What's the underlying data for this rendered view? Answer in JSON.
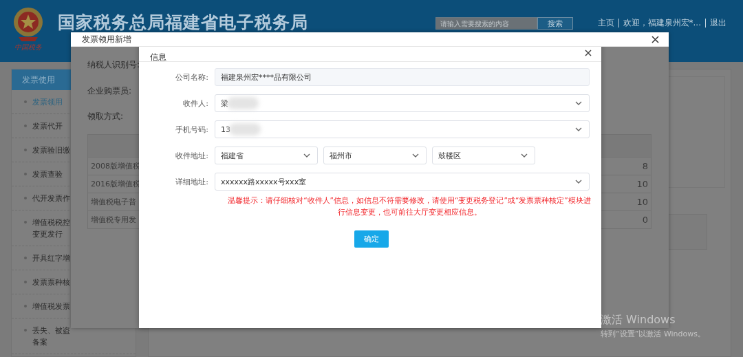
{
  "header": {
    "logo_text": "中国税务",
    "title": "国家税务总局福建省电子税务局",
    "search": {
      "placeholder": "请输入需要搜索的内容",
      "button": "搜索"
    },
    "links": [
      "主页",
      "欢迎，福建泉州宏*...",
      "退出"
    ]
  },
  "sidebar": {
    "title": "发票使用",
    "items": [
      {
        "label": "发票领用",
        "selected": true
      },
      {
        "label": "发票代开",
        "selected": false
      },
      {
        "label": "发票验旧缴",
        "selected": false
      },
      {
        "label": "发票查验",
        "selected": false
      },
      {
        "label": "代开发票作",
        "selected": false
      },
      {
        "label": "增值税税控变更发行",
        "selected": false
      },
      {
        "label": "开具红字增",
        "selected": false
      },
      {
        "label": "发票票种核",
        "selected": false
      },
      {
        "label": "增值税发票",
        "selected": false
      },
      {
        "label": "丢失、被盗备案",
        "selected": false
      }
    ]
  },
  "invoice_dialog": {
    "title": "发票领用新增",
    "fields": [
      "纳税人识别号:",
      "企业购票员:",
      "领取方式:"
    ],
    "table": {
      "rows": [
        [
          "2008版增值税",
          "8"
        ],
        [
          "2016版增值税",
          "10"
        ],
        [
          "增值税电子普",
          "10"
        ],
        [
          "增值税专用发",
          "0"
        ]
      ]
    }
  },
  "info_dialog": {
    "title": "信息",
    "fields": [
      {
        "kind": "readonly",
        "label": "公司名称:",
        "value": "福建泉州宏****品有限公司"
      },
      {
        "kind": "select",
        "label": "收件人:",
        "value": "梁",
        "redacted": true
      },
      {
        "kind": "select",
        "label": "手机号码:",
        "value": "13",
        "redacted": true
      },
      {
        "kind": "address",
        "label": "收件地址:",
        "values": [
          "福建省",
          "福州市",
          "鼓楼区"
        ]
      },
      {
        "kind": "select",
        "label": "详细地址:",
        "value": "xxxxxx路xxxxx号xxx室"
      }
    ],
    "notice": "温馨提示：请仔细核对“收件人”信息，如信息不符需要修改，请使用“变更税务登记”或“发票票种核定”模块进行信息变更，也可前往大厅变更相应信息。",
    "confirm": "确定"
  },
  "activation": {
    "title": "激活 Windows",
    "text": "转到“设置”以激活 Windows。"
  }
}
